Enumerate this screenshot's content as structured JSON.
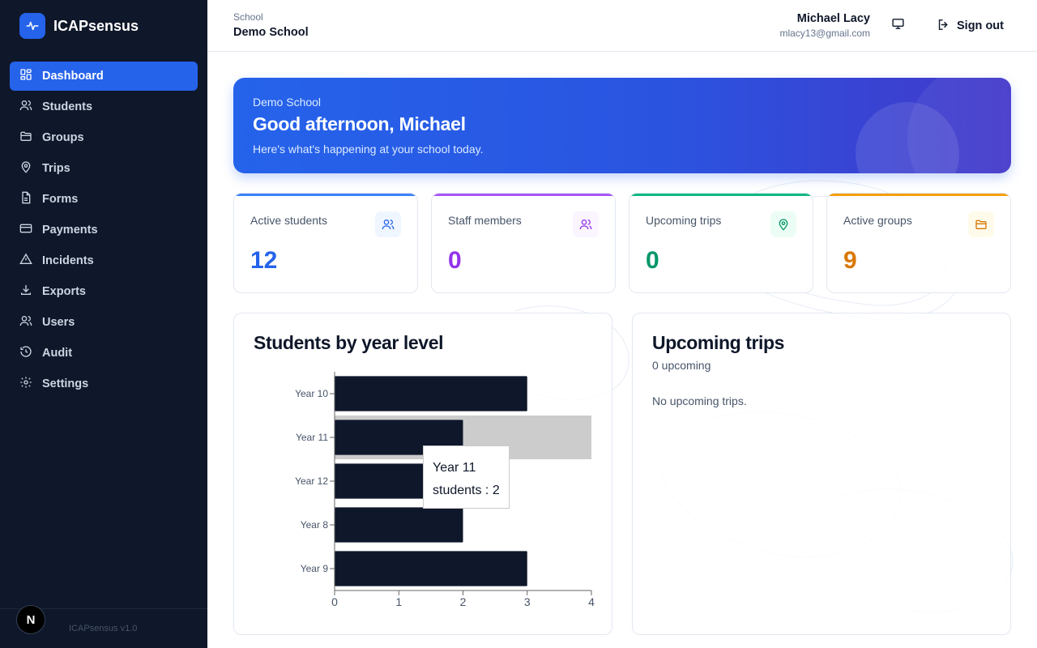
{
  "app": {
    "name": "ICAPsensus",
    "version": "ICAPsensus v1.0"
  },
  "sidebar": {
    "items": [
      {
        "label": "Dashboard",
        "icon": "dashboard-icon",
        "active": true
      },
      {
        "label": "Students",
        "icon": "users-icon"
      },
      {
        "label": "Groups",
        "icon": "folder-icon"
      },
      {
        "label": "Trips",
        "icon": "map-pin-icon"
      },
      {
        "label": "Forms",
        "icon": "file-text-icon"
      },
      {
        "label": "Payments",
        "icon": "credit-card-icon"
      },
      {
        "label": "Incidents",
        "icon": "alert-triangle-icon"
      },
      {
        "label": "Exports",
        "icon": "download-icon"
      },
      {
        "label": "Users",
        "icon": "users-icon"
      },
      {
        "label": "Audit",
        "icon": "history-icon"
      },
      {
        "label": "Settings",
        "icon": "gear-icon"
      }
    ],
    "footer_badge": "N"
  },
  "header": {
    "school_label": "School",
    "school_name": "Demo School",
    "user_name": "Michael Lacy",
    "user_email": "mlacy13@gmail.com",
    "signout_label": "Sign out"
  },
  "hero": {
    "school": "Demo School",
    "greeting": "Good afternoon, Michael",
    "subtitle": "Here's what's happening at your school today."
  },
  "stats": [
    {
      "label": "Active students",
      "value": "12",
      "color": "#2563eb",
      "icon": "users-icon"
    },
    {
      "label": "Staff members",
      "value": "0",
      "color": "#9333ea",
      "icon": "users-icon"
    },
    {
      "label": "Upcoming trips",
      "value": "0",
      "color": "#059669",
      "icon": "map-pin-icon"
    },
    {
      "label": "Active groups",
      "value": "9",
      "color": "#d97706",
      "icon": "folder-icon"
    }
  ],
  "students_panel": {
    "title": "Students by year level"
  },
  "trips_panel": {
    "title": "Upcoming trips",
    "count_text": "0 upcoming",
    "empty_text": "No upcoming trips."
  },
  "chart_data": {
    "type": "bar",
    "orientation": "horizontal",
    "categories": [
      "Year 10",
      "Year 11",
      "Year 12",
      "Year 8",
      "Year 9"
    ],
    "series": [
      {
        "name": "students",
        "values": [
          3,
          2,
          2,
          2,
          3
        ]
      }
    ],
    "xlim": [
      0,
      4
    ],
    "xticks": [
      0,
      1,
      2,
      3,
      4
    ],
    "bar_color": "#0f172a",
    "highlight_category": "Year 11",
    "tooltip": {
      "title": "Year 11",
      "text": "students : 2"
    }
  }
}
